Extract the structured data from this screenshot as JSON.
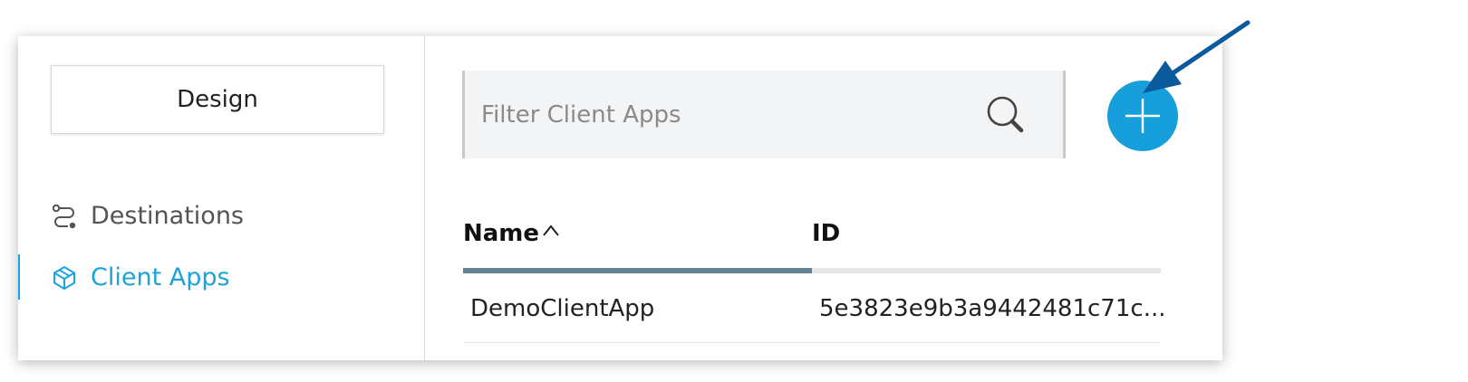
{
  "sidebar": {
    "design_label": "Design",
    "items": [
      {
        "label": "Destinations",
        "icon": "route-icon",
        "active": false
      },
      {
        "label": "Client Apps",
        "icon": "cube-icon",
        "active": true
      }
    ]
  },
  "search": {
    "placeholder": "Filter Client Apps",
    "value": ""
  },
  "add_button": {
    "icon": "plus-icon"
  },
  "table": {
    "columns": [
      {
        "label": "Name",
        "sort": "ascending"
      },
      {
        "label": "ID"
      }
    ],
    "rows": [
      {
        "name": "DemoClientApp",
        "id": "5e3823e9b3a9442481c71c..."
      }
    ]
  },
  "colors": {
    "accent": "#1ba3dc",
    "add_button": "#169fdb",
    "annotation_arrow": "#0a5a9c",
    "header_underline": "#648392"
  }
}
